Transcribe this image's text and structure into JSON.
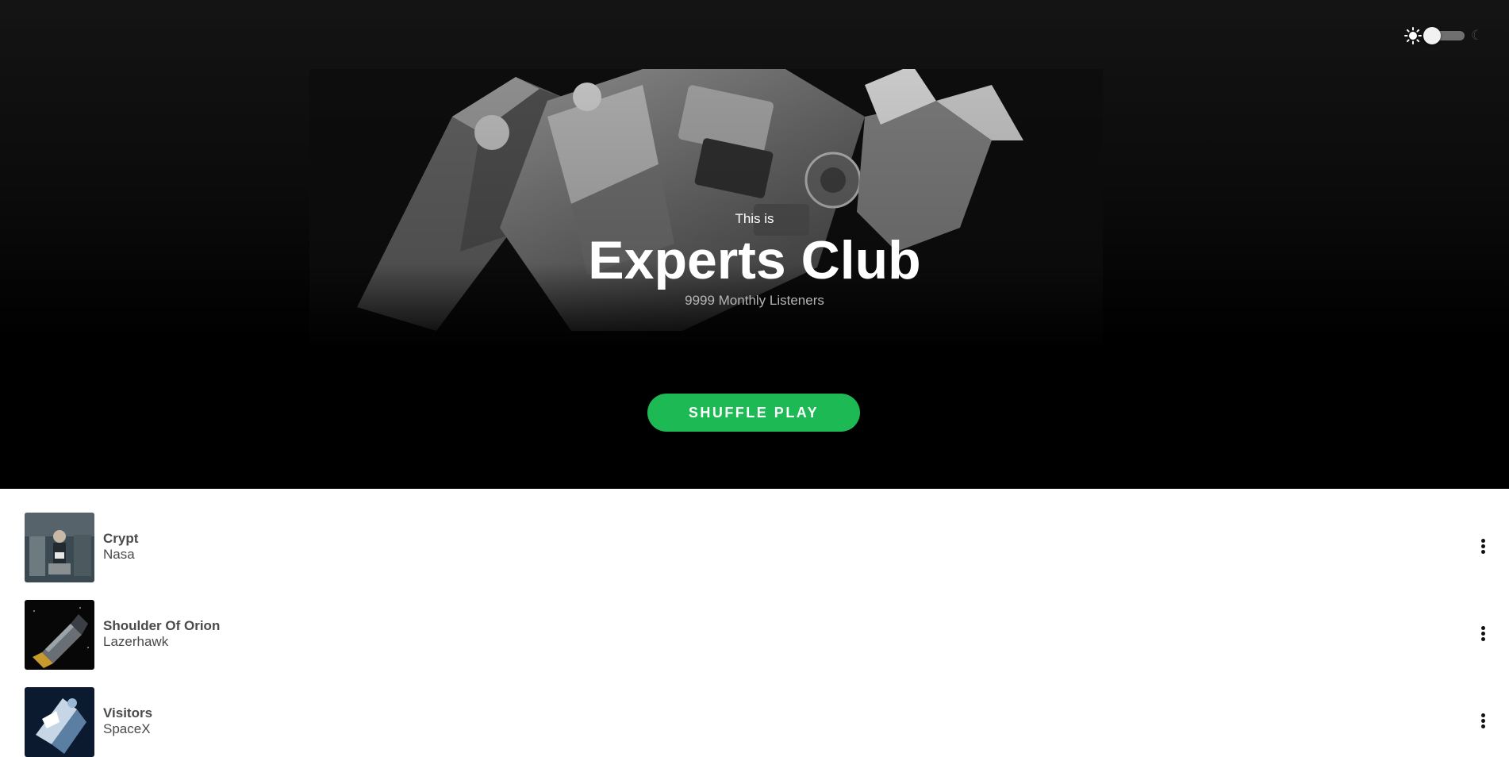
{
  "theme_toggle": {
    "sun_icon": "sun-icon",
    "moon_icon": "moon-icon",
    "moon_glyph": "☾",
    "state": "light"
  },
  "hero": {
    "eyebrow": "This is",
    "title": "Experts Club",
    "listeners": "9999 Monthly Listeners",
    "shuffle_label": "SHUFFLE PLAY",
    "accent": "#1db954"
  },
  "tracks": [
    {
      "title": "Crypt",
      "artist": "Nasa"
    },
    {
      "title": "Shoulder Of Orion",
      "artist": "Lazerhawk"
    },
    {
      "title": "Visitors",
      "artist": "SpaceX"
    }
  ]
}
